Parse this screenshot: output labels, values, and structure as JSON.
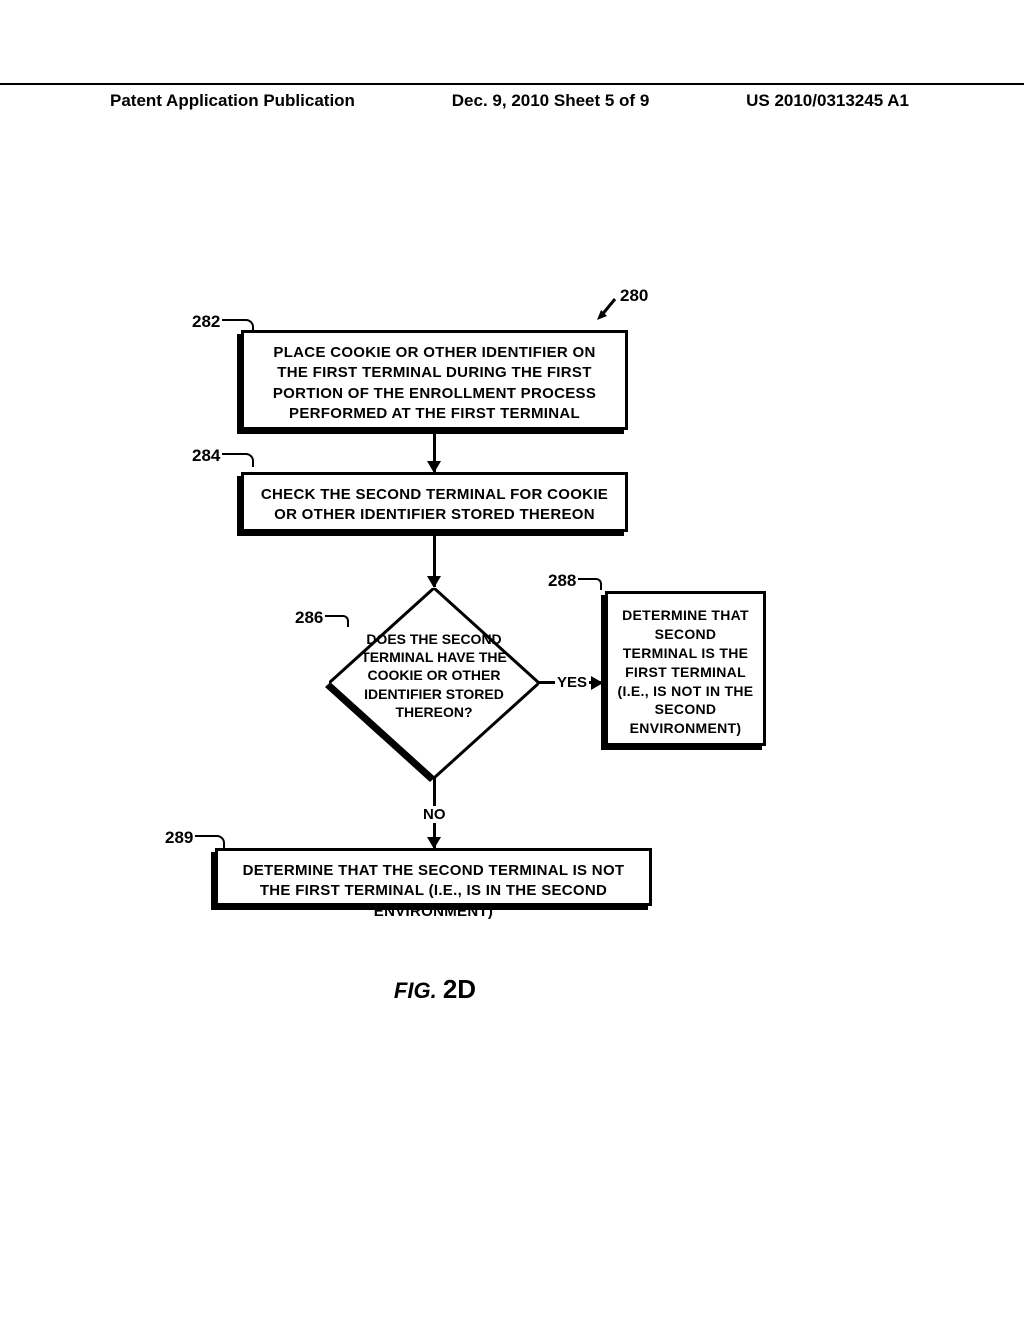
{
  "header": {
    "left": "Patent Application Publication",
    "center": "Dec. 9, 2010   Sheet 5 of 9",
    "right": "US 2010/0313245 A1"
  },
  "refs": {
    "r280": "280",
    "r282": "282",
    "r284": "284",
    "r286": "286",
    "r288": "288",
    "r289": "289"
  },
  "boxes": {
    "b282": "PLACE COOKIE OR OTHER IDENTIFIER ON THE FIRST TERMINAL DURING THE FIRST PORTION OF THE ENROLLMENT PROCESS PERFORMED AT THE FIRST TERMINAL",
    "b284": "CHECK THE SECOND TERMINAL FOR COOKIE OR OTHER IDENTIFIER STORED THEREON",
    "b286": "DOES THE SECOND TERMINAL HAVE THE COOKIE OR OTHER IDENTIFIER STORED THEREON?",
    "b288": "DETERMINE THAT SECOND TERMINAL IS THE FIRST TERMINAL (I.E., IS NOT IN THE SECOND ENVIRONMENT)",
    "b289": "DETERMINE THAT THE SECOND TERMINAL IS NOT THE FIRST TERMINAL (I.E., IS IN THE SECOND ENVIRONMENT)"
  },
  "edges": {
    "yes": "YES",
    "no": "NO"
  },
  "figure": {
    "prefix": "FIG. ",
    "num": "2D"
  },
  "chart_data": {
    "type": "flowchart",
    "title": "FIG. 2D",
    "reference_numeral": "280",
    "nodes": [
      {
        "id": "282",
        "type": "process",
        "text": "PLACE COOKIE OR OTHER IDENTIFIER ON THE FIRST TERMINAL DURING THE FIRST PORTION OF THE ENROLLMENT PROCESS PERFORMED AT THE FIRST TERMINAL"
      },
      {
        "id": "284",
        "type": "process",
        "text": "CHECK THE SECOND TERMINAL FOR COOKIE OR OTHER IDENTIFIER STORED THEREON"
      },
      {
        "id": "286",
        "type": "decision",
        "text": "DOES THE SECOND TERMINAL HAVE THE COOKIE OR OTHER IDENTIFIER STORED THEREON?"
      },
      {
        "id": "288",
        "type": "process",
        "text": "DETERMINE THAT SECOND TERMINAL IS THE FIRST TERMINAL (I.E., IS NOT IN THE SECOND ENVIRONMENT)"
      },
      {
        "id": "289",
        "type": "process",
        "text": "DETERMINE THAT THE SECOND TERMINAL IS NOT THE FIRST TERMINAL (I.E., IS IN THE SECOND ENVIRONMENT)"
      }
    ],
    "edges": [
      {
        "from": "282",
        "to": "284",
        "label": ""
      },
      {
        "from": "284",
        "to": "286",
        "label": ""
      },
      {
        "from": "286",
        "to": "288",
        "label": "YES"
      },
      {
        "from": "286",
        "to": "289",
        "label": "NO"
      }
    ]
  }
}
